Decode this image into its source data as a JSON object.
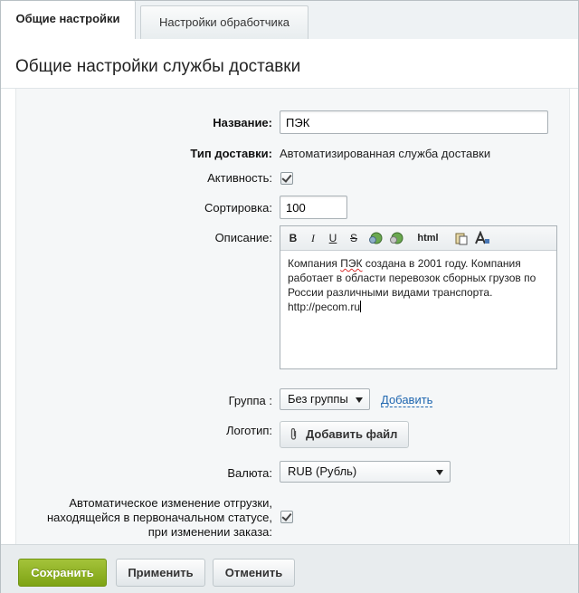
{
  "tabs": [
    {
      "label": "Общие настройки",
      "active": true
    },
    {
      "label": "Настройки обработчика",
      "active": false
    }
  ],
  "section_title": "Общие настройки службы доставки",
  "form": {
    "name": {
      "label": "Название:",
      "value": "ПЭК"
    },
    "delivery_type": {
      "label": "Тип доставки:",
      "value": "Автоматизированная служба доставки"
    },
    "active": {
      "label": "Активность:",
      "checked": true
    },
    "sort": {
      "label": "Сортировка:",
      "value": "100"
    },
    "description": {
      "label": "Описание:",
      "toolbar": {
        "bold": "B",
        "italic": "I",
        "underline": "U",
        "strike": "S",
        "html": "html"
      },
      "text_before": "Компания ",
      "text_spell": "ПЭК",
      "text_after": " создана в 2001 году. Компания работает в области перевозок сборных грузов по России различными видами транспорта. http://pecom.ru"
    },
    "group": {
      "label": "Группа :",
      "value": "Без группы",
      "add_link": "Добавить"
    },
    "logo": {
      "label": "Логотип:",
      "button": "Добавить файл"
    },
    "currency": {
      "label": "Валюта:",
      "value": "RUB (Рубль)"
    },
    "auto_shipment": {
      "label_line1": "Автоматическое изменение отгрузки,",
      "label_line2": "находящейся в первоначальном статусе,",
      "label_line3": "при изменении заказа:",
      "checked": true
    }
  },
  "footer": {
    "save": "Сохранить",
    "apply": "Применить",
    "cancel": "Отменить"
  },
  "colors": {
    "accent_green": "#8db024",
    "link_blue": "#2067b0"
  }
}
